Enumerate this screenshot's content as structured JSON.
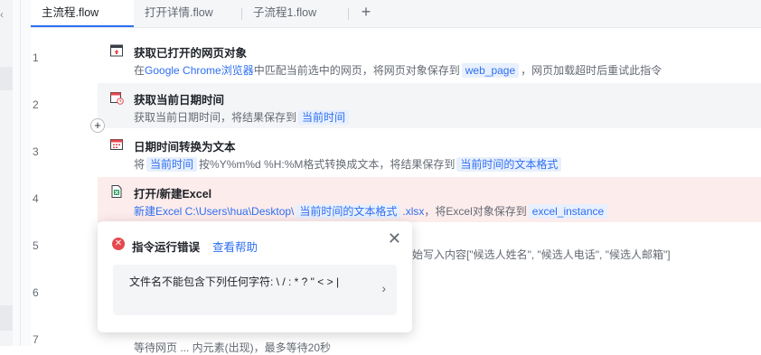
{
  "tabs": [
    {
      "label": "主流程.flow",
      "active": true
    },
    {
      "label": "打开详情.flow",
      "active": false
    },
    {
      "label": "子流程1.flow",
      "active": false
    }
  ],
  "tab_add": "+",
  "rows": [
    {
      "num": "1",
      "title": "获取已打开的网页对象",
      "d1": "在",
      "d2": "Google Chrome浏览器",
      "d3": "中匹配当前选中的网页，将网页对象保存到",
      "d4": "web_page",
      "d5": "，网页加载超时后重试此指令"
    },
    {
      "num": "2",
      "title": "获取当前日期时间",
      "d1": "获取当前日期时间，将结果保存到",
      "d2": "当前时间"
    },
    {
      "num": "3",
      "title": "日期时间转换为文本",
      "d1": "将",
      "d2": "当前时间",
      "d3": "按%Y%m%d %H:%M格式转换成文本，将结果保存到",
      "d4": "当前时间的文本格式"
    },
    {
      "num": "4",
      "title": "打开/新建Excel",
      "d1": "新建Excel C:\\Users\\hua\\Desktop\\",
      "d2": "当前时间的文本格式",
      "d3": ".xlsx",
      "d4": "，将Excel对象保存到",
      "d5": "excel_instance"
    },
    {
      "num": "5",
      "tail": "始写入内容[\"候选人姓名\", \"候选人电话\", \"候选人邮箱\"]"
    },
    {
      "num": "6"
    },
    {
      "num": "7",
      "peek": "等待网页 ... 内元素(出现)，最多等待20秒"
    }
  ],
  "popup": {
    "title": "指令运行错误",
    "help": "查看帮助",
    "close": "✕",
    "message": "文件名不能包含下列任何字符: \\ / : * ? \" < > |",
    "arrow": "›"
  },
  "left_strip": {
    "chevron": "‹"
  }
}
